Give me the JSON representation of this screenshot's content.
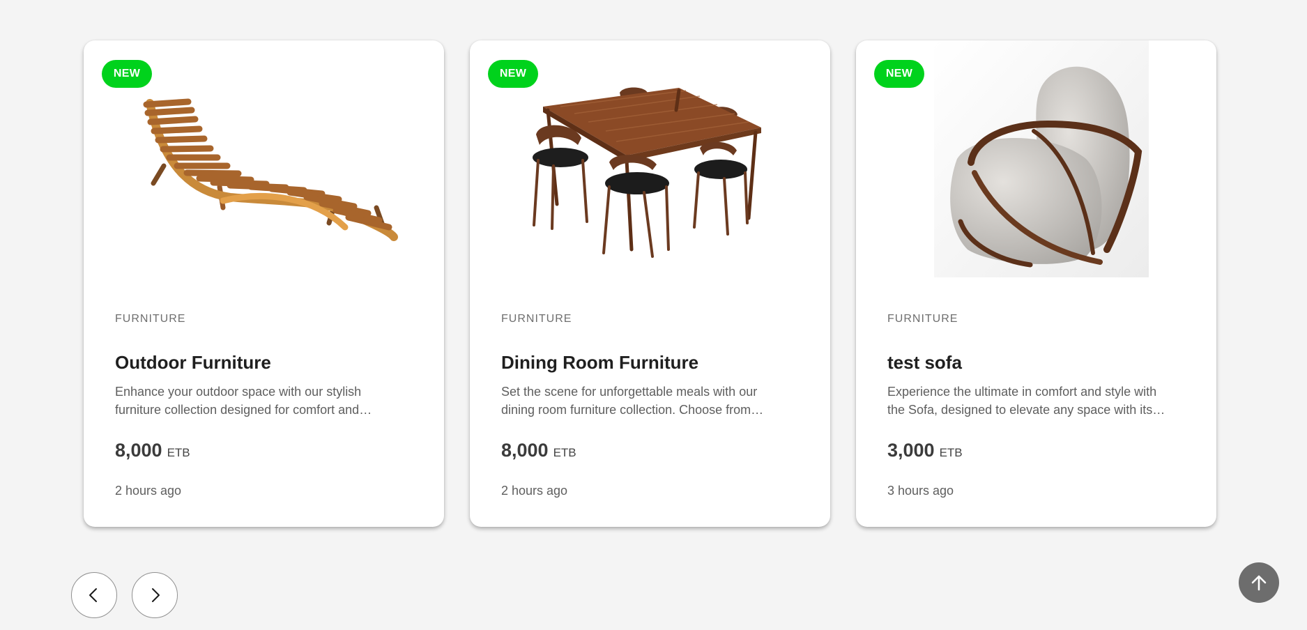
{
  "products": [
    {
      "badge": "NEW",
      "category": "FURNITURE",
      "title": "Outdoor Furniture",
      "description": "Enhance your outdoor space with our stylish furniture collection designed for comfort and durability in every season.",
      "price": "8,000",
      "currency": "ETB",
      "time": "2 hours ago",
      "image": "wooden-lounger-image"
    },
    {
      "badge": "NEW",
      "category": "FURNITURE",
      "title": "Dining Room Furniture",
      "description": "Set the scene for unforgettable meals with our dining room furniture collection. Choose from elegant tables and chairs.",
      "price": "8,000",
      "currency": "ETB",
      "time": "2 hours ago",
      "image": "dining-set-image"
    },
    {
      "badge": "NEW",
      "category": "FURNITURE",
      "title": "test sofa",
      "description": "Experience the ultimate in comfort and style with the Sofa, designed to elevate any space with its modern look.",
      "price": "3,000",
      "currency": "ETB",
      "time": "3 hours ago",
      "image": "armchair-image"
    }
  ],
  "controls": {
    "prev_icon": "chevron-left-icon",
    "next_icon": "chevron-right-icon",
    "scroll_top_icon": "arrow-up-icon"
  },
  "colors": {
    "badge": "#00d21c",
    "background": "#f4f4f4",
    "scroll_top": "#6d6d6d"
  }
}
